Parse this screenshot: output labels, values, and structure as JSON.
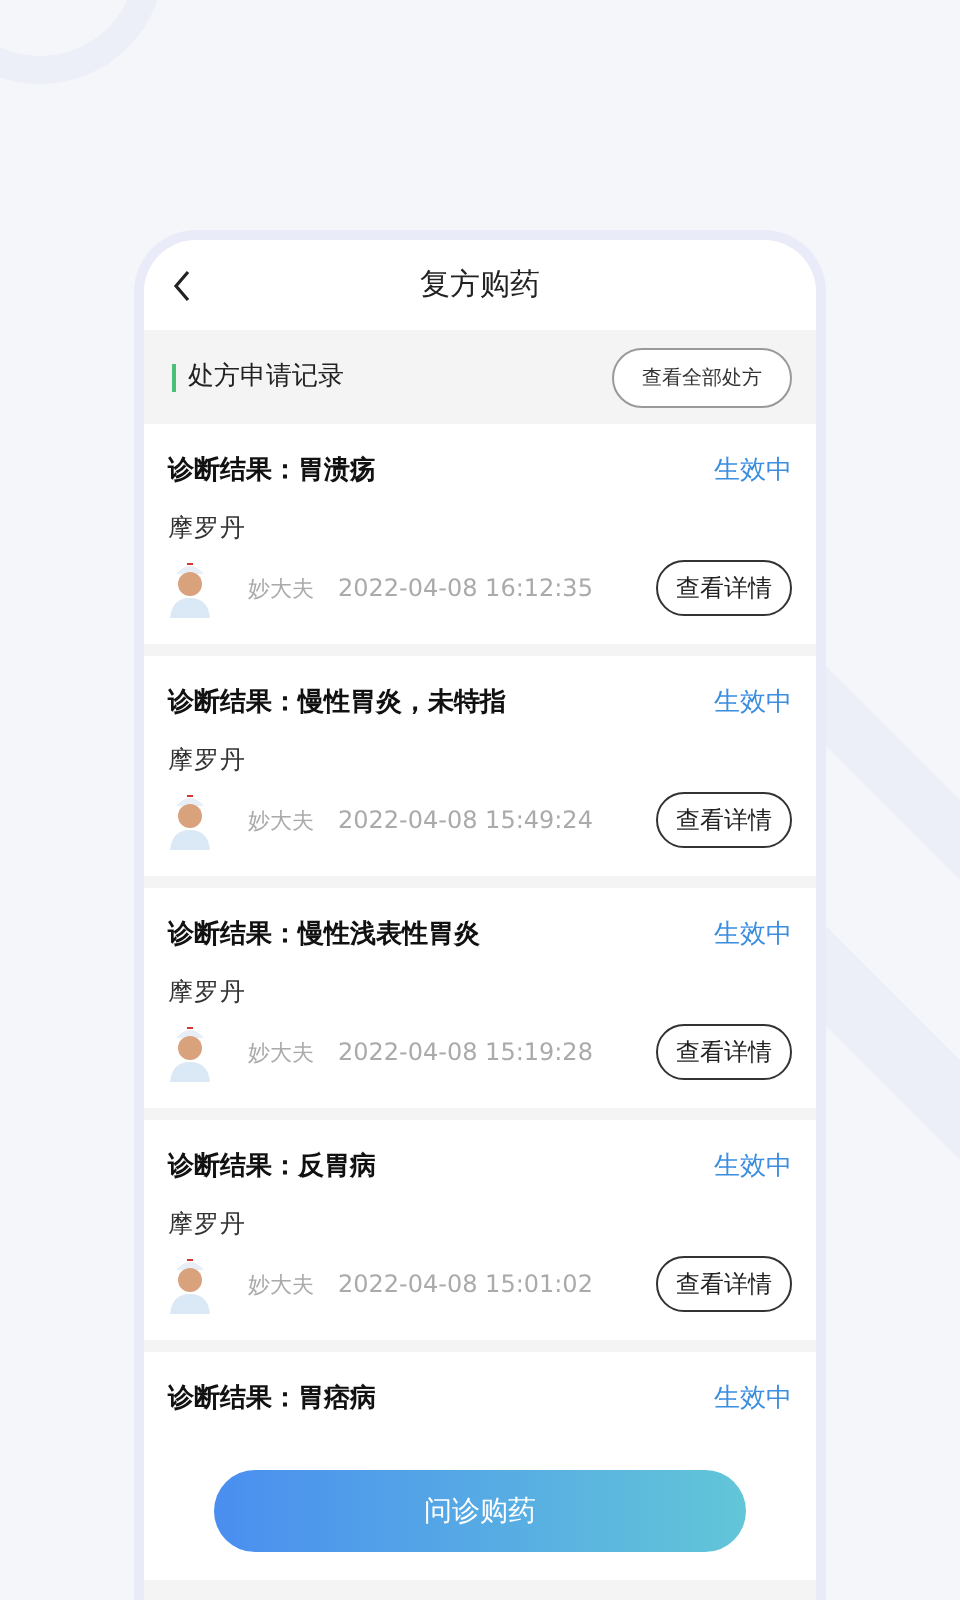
{
  "header": {
    "title": "复方购药"
  },
  "section": {
    "title": "处方申请记录",
    "button": "查看全部处方"
  },
  "records": [
    {
      "label": "诊断结果：",
      "diagnosis": "胃溃疡",
      "status": "生效中",
      "drug": "摩罗丹",
      "doctor": "妙大夫",
      "time": "2022-04-08 16:12:35",
      "button": "查看详情"
    },
    {
      "label": "诊断结果：",
      "diagnosis": "慢性胃炎，未特指",
      "status": "生效中",
      "drug": "摩罗丹",
      "doctor": "妙大夫",
      "time": "2022-04-08 15:49:24",
      "button": "查看详情"
    },
    {
      "label": "诊断结果：",
      "diagnosis": "慢性浅表性胃炎",
      "status": "生效中",
      "drug": "摩罗丹",
      "doctor": "妙大夫",
      "time": "2022-04-08 15:19:28",
      "button": "查看详情"
    },
    {
      "label": "诊断结果：",
      "diagnosis": "反胃病",
      "status": "生效中",
      "drug": "摩罗丹",
      "doctor": "妙大夫",
      "time": "2022-04-08 15:01:02",
      "button": "查看详情"
    },
    {
      "label": "诊断结果：",
      "diagnosis": "胃痞病",
      "status": "生效中"
    }
  ],
  "action_button": "问诊购药"
}
